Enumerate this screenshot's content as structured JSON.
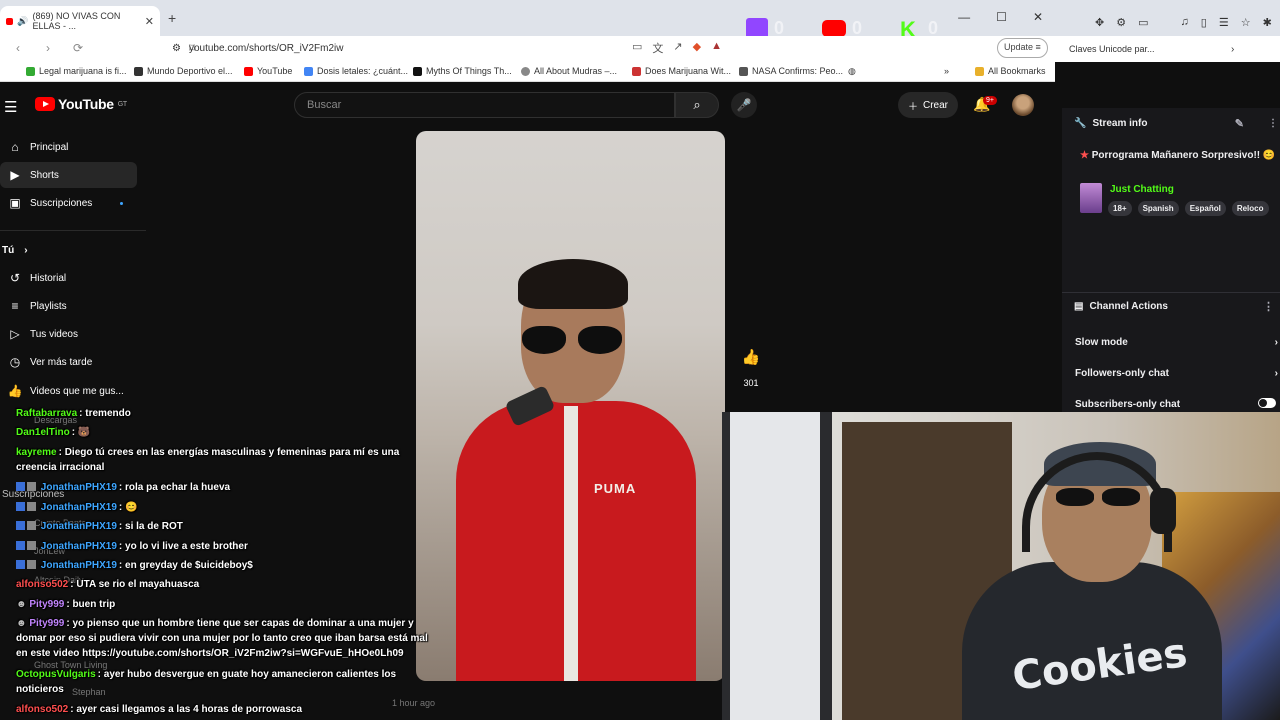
{
  "browser": {
    "tab_title": "(869) NO VIVAS CON ELLAS - ...",
    "url": "youtube.com/shorts/OR_iV2Fm2iw",
    "update_label": "Update",
    "bookmarks": [
      "Legal marijuana is fi...",
      "Mundo Deportivo el...",
      "YouTube",
      "Dosis letales: ¿cuánt...",
      "Myths Of Things Th...",
      "All About Mudras –...",
      "Does Marijuana Wit...",
      "NASA Confirms: Peo...",
      "All Bookmarks"
    ],
    "second_window_bookmark": "Claves Unicode par..."
  },
  "youtube": {
    "logo_text": "YouTube",
    "logo_region": "GT",
    "search_placeholder": "Buscar",
    "create_label": "Crear",
    "notif_badge": "9+",
    "sidebar": [
      {
        "label": "Principal",
        "icon": "home-icon"
      },
      {
        "label": "Shorts",
        "icon": "shorts-icon"
      },
      {
        "label": "Suscripciones",
        "icon": "subscriptions-icon"
      },
      {
        "label": "Tú",
        "icon": ""
      },
      {
        "label": "Historial",
        "icon": "history-icon"
      },
      {
        "label": "Playlists",
        "icon": "playlists-icon"
      },
      {
        "label": "Tus videos",
        "icon": "your-videos-icon"
      },
      {
        "label": "Ver más tarde",
        "icon": "watch-later-icon"
      },
      {
        "label": "Videos que me gus...",
        "icon": "like-icon"
      }
    ],
    "like_count": "301",
    "video_jacket_text": "PUMA"
  },
  "twitch": {
    "stream_info_title": "Stream info",
    "stream_title": "Porrograma Mañanero Sorpresivo!! 😊",
    "category": "Just Chatting",
    "tags": [
      "18+",
      "Spanish",
      "Español",
      "Reloco"
    ],
    "channel_actions_title": "Channel Actions",
    "actions": [
      "Slow mode",
      "Followers-only chat",
      "Subscribers-only chat"
    ]
  },
  "overlay_counts": {
    "twitch": "0",
    "youtube": "0",
    "kick": "0"
  },
  "webcam_shirt_text": "Cookies",
  "chat": [
    {
      "user": "Raftabarrava",
      "color": "#53fc18",
      "text": "tremendo"
    },
    {
      "user": "Dan1elTino",
      "color": "#53fc18",
      "text": "🐻"
    },
    {
      "user": "kayreme",
      "color": "#53fc18",
      "text": "Diego tú crees en las energías masculinas y femeninas para mí es una creencia irracional"
    },
    {
      "user": "JonathanPHX19",
      "color": "#3ea6ff",
      "text": "rola pa echar la hueva"
    },
    {
      "user": "JonathanPHX19",
      "color": "#3ea6ff",
      "text": "😊"
    },
    {
      "user": "JonathanPHX19",
      "color": "#3ea6ff",
      "text": "si la de ROT"
    },
    {
      "user": "JonathanPHX19",
      "color": "#3ea6ff",
      "text": "yo lo vi live a este brother"
    },
    {
      "user": "JonathanPHX19",
      "color": "#3ea6ff",
      "text": "en greyday de $uicideboy$"
    },
    {
      "user": "alfonso502",
      "color": "#ff4f4f",
      "text": "UTA se rio el mayahuasca"
    },
    {
      "user": "Pity999",
      "color": "#c084fc",
      "text": "buen trip"
    },
    {
      "user": "Pity999",
      "color": "#c084fc",
      "text": "yo pienso que un hombre tiene que ser capas de dominar a una mujer y domar por eso si pudiera vivir con una mujer por lo tanto creo que iban barsa está mal en este video https://youtube.com/shorts/OR_iV2Fm2iw?si=WGFvuE_hHOe0Lh09"
    },
    {
      "user": "OctopusVulgaris",
      "color": "#53fc18",
      "text": "ayer hubo desvergue en guate hoy amanecieron calientes los noticieros"
    },
    {
      "user": "alfonso502",
      "color": "#ff4f4f",
      "text": "ayer casi llegamos a las 4 horas de porrowasca"
    }
  ],
  "ghost_text": [
    "Descargas",
    "Suscripciones",
    "Crypto Banter",
    "JonLew",
    "Altcoin Daily",
    "Ghost Town Living",
    "Stephan",
    "1 hour ago"
  ]
}
